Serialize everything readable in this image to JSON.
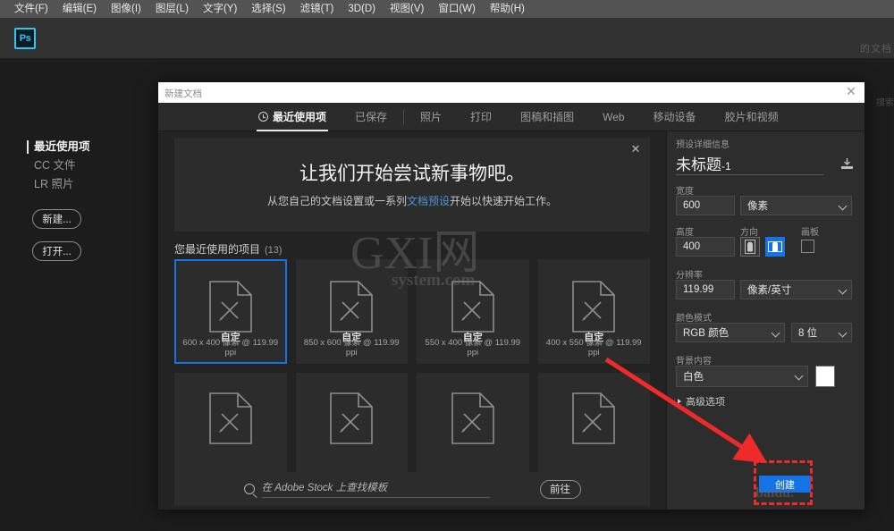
{
  "menubar": {
    "logo": "Ps",
    "items": [
      {
        "label": "文件(F)"
      },
      {
        "label": "编辑(E)"
      },
      {
        "label": "图像(I)"
      },
      {
        "label": "图层(L)"
      },
      {
        "label": "文字(Y)"
      },
      {
        "label": "选择(S)"
      },
      {
        "label": "滤镜(T)"
      },
      {
        "label": "3D(D)"
      },
      {
        "label": "视图(V)"
      },
      {
        "label": "窗口(W)"
      },
      {
        "label": "帮助(H)"
      }
    ]
  },
  "workspace": {
    "bg_text_right": "的文档",
    "bg_text_right2": "搜索"
  },
  "rail": {
    "items": [
      {
        "label": "最近使用项"
      },
      {
        "label": "CC 文件"
      },
      {
        "label": "LR 照片"
      }
    ],
    "new_button": "新建...",
    "open_button": "打开..."
  },
  "dialog": {
    "title": "新建文档",
    "close": "✕",
    "tabs": [
      {
        "label": "最近使用项",
        "icon": "clock-icon",
        "active": true
      },
      {
        "label": "已保存",
        "active": false
      },
      {
        "label": "照片",
        "active": false
      },
      {
        "label": "打印",
        "active": false
      },
      {
        "label": "图稿和插图",
        "active": false
      },
      {
        "label": "Web",
        "active": false
      },
      {
        "label": "移动设备",
        "active": false
      },
      {
        "label": "胶片和视频",
        "active": false
      }
    ],
    "banner": {
      "heading": "让我们开始尝试新事物吧。",
      "body_pre": "从您自己的文档设置或一系列",
      "body_link": "文档预设",
      "body_post": "开始以快速开始工作。",
      "close": "✕"
    },
    "recent": {
      "heading": "您最近使用的项目",
      "count": "(13)",
      "items": [
        {
          "name": "自定",
          "detail": "600 x 400 像素 @ 119.99 ppi",
          "selected": true
        },
        {
          "name": "自定",
          "detail": "850 x 600 像素 @ 119.99 ppi",
          "selected": false
        },
        {
          "name": "自定",
          "detail": "550 x 400 像素 @ 119.99 ppi",
          "selected": false
        },
        {
          "name": "自定",
          "detail": "400 x 550 像素 @ 119.99 ppi",
          "selected": false
        }
      ],
      "items_row2": [
        {
          "name": "",
          "detail": ""
        },
        {
          "name": "",
          "detail": ""
        },
        {
          "name": "",
          "detail": ""
        },
        {
          "name": "",
          "detail": ""
        }
      ]
    },
    "search": {
      "icon": "search-icon",
      "placeholder": "在 Adobe Stock 上查找模板",
      "goto_label": "前往"
    },
    "preset": {
      "section_label": "预设详细信息",
      "doc_name": "未标题",
      "doc_name_suffix": "-1",
      "save_preset_icon": "save-preset-icon",
      "width_label": "宽度",
      "width_value": "600",
      "width_unit": "像素",
      "height_label": "高度",
      "height_value": "400",
      "orientation_label": "方向",
      "orientation_portrait": "portrait-icon",
      "orientation_landscape": "landscape-icon",
      "orientation_selected": "landscape",
      "artboard_label": "画板",
      "artboard_checked": false,
      "resolution_label": "分辨率",
      "resolution_value": "119.99",
      "resolution_unit": "像素/英寸",
      "color_mode_label": "颜色模式",
      "color_mode_value": "RGB 颜色",
      "bit_depth_value": "8 位",
      "background_label": "背景内容",
      "background_value": "白色",
      "background_swatch": "#ffffff",
      "advanced_label": "高级选项"
    },
    "create_button": "创建"
  },
  "annotation": {
    "arrow_color": "#ef2a2a",
    "highlight_color": "#ef2a2a"
  },
  "watermark": {
    "big": "GXI网",
    "small": "system.com",
    "bottom": "baidu."
  },
  "colors": {
    "accent_blue": "#1473e6",
    "logo_blue": "#31c5f0",
    "panel_bg": "#2d2d2d",
    "dialog_bg": "#232323"
  }
}
